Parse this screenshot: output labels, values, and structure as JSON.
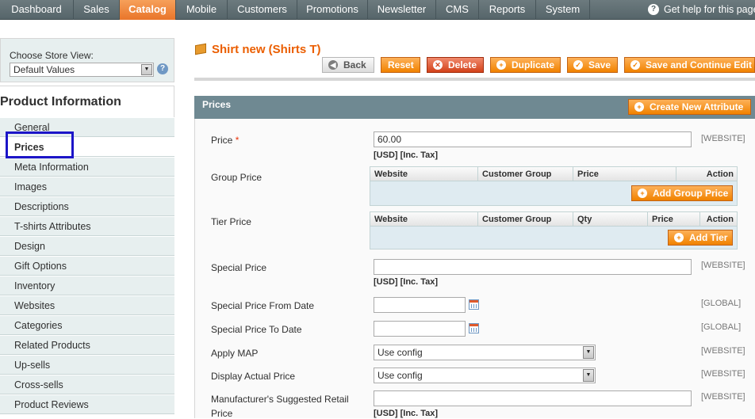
{
  "nav": {
    "items": [
      "Dashboard",
      "Sales",
      "Catalog",
      "Mobile",
      "Customers",
      "Promotions",
      "Newsletter",
      "CMS",
      "Reports",
      "System"
    ],
    "active": "Catalog",
    "help": "Get help for this page"
  },
  "store": {
    "label": "Choose Store View:",
    "value": "Default Values"
  },
  "sidebar": {
    "title": "Product Information",
    "tabs": [
      "General",
      "Prices",
      "Meta Information",
      "Images",
      "Descriptions",
      "T-shirts Attributes",
      "Design",
      "Gift Options",
      "Inventory",
      "Websites",
      "Categories",
      "Related Products",
      "Up-sells",
      "Cross-sells",
      "Product Reviews"
    ],
    "active": "Prices"
  },
  "header": {
    "title": "Shirt new (Shirts T)",
    "buttons": {
      "back": "Back",
      "reset": "Reset",
      "delete": "Delete",
      "duplicate": "Duplicate",
      "save": "Save",
      "save_continue": "Save and Continue Edit"
    }
  },
  "section": {
    "title": "Prices",
    "create_attr": "Create New Attribute"
  },
  "fields": {
    "price": {
      "label": "Price",
      "required": "*",
      "value": "60.00",
      "note": "[USD] [Inc. Tax]",
      "scope": "[WEBSITE]"
    },
    "group_price": {
      "label": "Group Price",
      "cols": [
        "Website",
        "Customer Group",
        "Price",
        "Action"
      ],
      "button": "Add Group Price"
    },
    "tier_price": {
      "label": "Tier Price",
      "cols": [
        "Website",
        "Customer Group",
        "Qty",
        "Price",
        "Action"
      ],
      "button": "Add Tier"
    },
    "special_price": {
      "label": "Special Price",
      "value": "",
      "note": "[USD] [Inc. Tax]",
      "scope": "[WEBSITE]"
    },
    "special_from": {
      "label": "Special Price From Date",
      "scope": "[GLOBAL]"
    },
    "special_to": {
      "label": "Special Price To Date",
      "scope": "[GLOBAL]"
    },
    "apply_map": {
      "label": "Apply MAP",
      "value": "Use config",
      "scope": "[WEBSITE]"
    },
    "display_actual": {
      "label": "Display Actual Price",
      "value": "Use config",
      "scope": "[WEBSITE]"
    },
    "msrp": {
      "label_line1": "Manufacturer's Suggested Retail",
      "label_line2": "Price",
      "note": "[USD] [Inc. Tax]",
      "scope": "[WEBSITE]"
    }
  }
}
